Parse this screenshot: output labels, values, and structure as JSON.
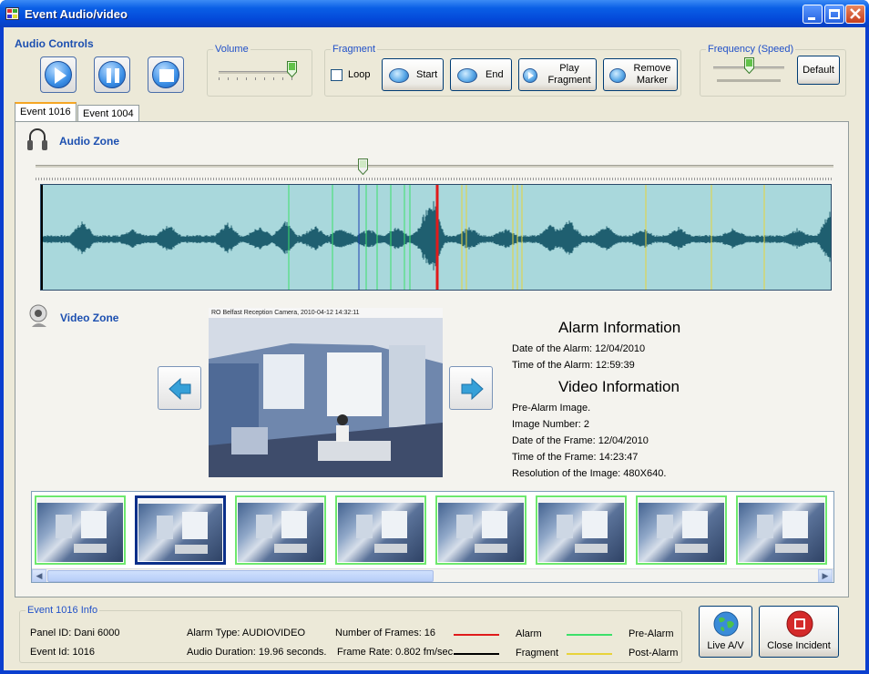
{
  "window": {
    "title": "Event Audio/video"
  },
  "audio_controls": {
    "label": "Audio Controls"
  },
  "volume": {
    "label": "Volume",
    "level": 0.95
  },
  "fragment": {
    "label": "Fragment",
    "loop_label": "Loop",
    "loop_checked": false,
    "start_label": "Start",
    "end_label": "End",
    "play_label_1": "Play",
    "play_label_2": "Fragment",
    "remove_label_1": "Remove",
    "remove_label_2": "Marker"
  },
  "frequency": {
    "label": "Frequency (Speed)",
    "default_label": "Default",
    "level": 0.5
  },
  "tabs": [
    {
      "label": "Event 1016",
      "active": true
    },
    {
      "label": "Event 1004",
      "active": false
    }
  ],
  "audio_zone": {
    "label": "Audio Zone",
    "position": 0.41
  },
  "video_zone": {
    "label": "Video Zone",
    "camera_caption": "RO Belfast Reception Camera, 2010-04-12 14:32:11"
  },
  "alarm_info": {
    "heading": "Alarm Information",
    "date": "Date of the Alarm: 12/04/2010",
    "time": "Time of the Alarm: 12:59:39"
  },
  "video_info": {
    "heading": "Video Information",
    "type": "Pre-Alarm Image.",
    "image_number": "Image Number: 2",
    "frame_date": "Date of the Frame: 12/04/2010",
    "frame_time": "Time of the Frame: 14:23:47",
    "resolution": "Resolution of the Image: 480X640."
  },
  "thumbnails": {
    "count": 8,
    "selected_index": 1
  },
  "event_info": {
    "label": "Event 1016 Info",
    "panel_id": "Panel ID: Dani 6000",
    "event_id": "Event Id: 1016",
    "alarm_type": "Alarm Type: AUDIOVIDEO",
    "audio_duration": "Audio Duration: 19.96 seconds.",
    "num_frames": "Number of Frames: 16",
    "frame_rate": "Frame Rate: 0.802 fm/sec"
  },
  "legend": {
    "alarm": "Alarm",
    "fragment": "Fragment",
    "pre_alarm": "Pre-Alarm",
    "post_alarm": "Post-Alarm",
    "colors": {
      "alarm": "#e01b1b",
      "fragment": "#000000",
      "pre_alarm": "#3de06a",
      "post_alarm": "#e8d33a"
    }
  },
  "buttons": {
    "live_av": "Live A/V",
    "close_incident": "Close Incident"
  }
}
